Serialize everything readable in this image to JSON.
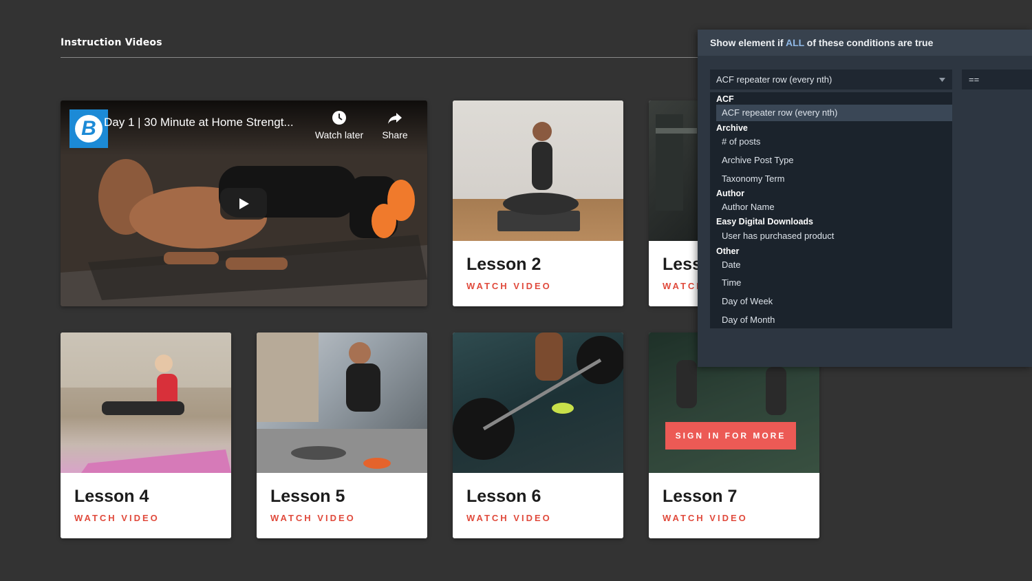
{
  "section": {
    "title": "Instruction Videos"
  },
  "video": {
    "title": "Day 1 | 30 Minute at Home Strengt...",
    "channel_logo_letter": "B",
    "watch_later_label": "Watch later",
    "share_label": "Share",
    "icons": [
      "clock-icon",
      "share-arrow-icon",
      "play-icon"
    ]
  },
  "cards": [
    {
      "title": "Lesson 2",
      "link": "WATCH VIDEO"
    },
    {
      "title": "Less",
      "link": "WATCH"
    },
    {
      "title": "Lesson 4",
      "link": "WATCH VIDEO"
    },
    {
      "title": "Lesson 5",
      "link": "WATCH VIDEO"
    },
    {
      "title": "Lesson 6",
      "link": "WATCH VIDEO"
    },
    {
      "title": "Lesson 7",
      "link": "WATCH VIDEO",
      "overlay_button": "SIGN IN FOR MORE"
    }
  ],
  "panel": {
    "title_prefix": "Show element if ",
    "title_accent": "ALL",
    "title_suffix": " of these conditions are true",
    "select_value": "ACF repeater row (every nth)",
    "operator_value": "==",
    "dropdown": {
      "groups": [
        {
          "label": "ACF",
          "options": [
            "ACF repeater row (every nth)"
          ]
        },
        {
          "label": "Archive",
          "options": [
            "# of posts",
            "Archive Post Type",
            "Taxonomy Term"
          ]
        },
        {
          "label": "Author",
          "options": [
            "Author Name"
          ]
        },
        {
          "label": "Easy Digital Downloads",
          "options": [
            "User has purchased product"
          ]
        },
        {
          "label": "Other",
          "options": [
            "Date",
            "Time",
            "Day of Week",
            "Day of Month"
          ]
        }
      ],
      "selected": "ACF repeater row (every nth)"
    }
  },
  "colors": {
    "background": "#333333",
    "accent_red": "#e04a3c",
    "sign_in_button": "#ec5a55",
    "panel_bg": "#2d3641",
    "panel_accent": "#8fb8e6"
  }
}
